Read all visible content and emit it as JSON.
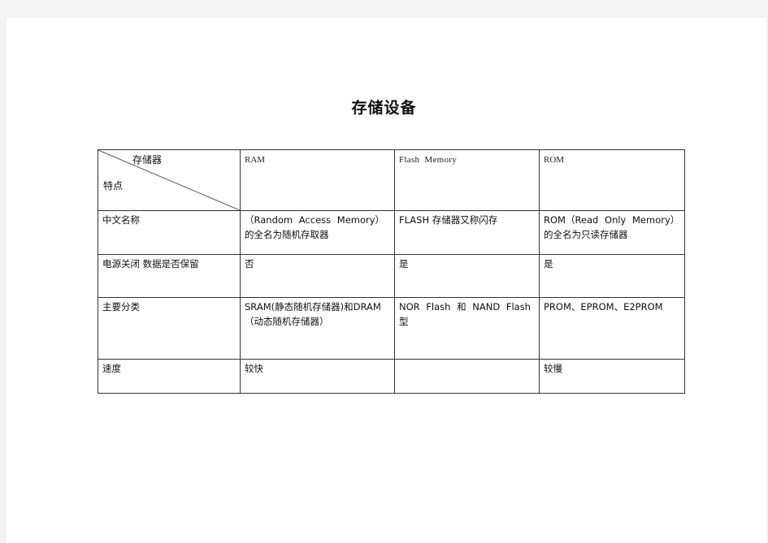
{
  "document": {
    "title": "存储设备"
  },
  "table": {
    "corner": {
      "top_label": "存储器",
      "bottom_label": "特点"
    },
    "columns": [
      "RAM",
      "Flash Memory",
      "ROM"
    ],
    "rows": [
      {
        "label": "中文名称",
        "cells": [
          "（Random Access Memory）的全名为随机存取器",
          "FLASH 存储器又称闪存",
          "ROM（Read Only Memory）的全名为只读存储器"
        ]
      },
      {
        "label": "电源关闭 数据是否保留",
        "cells": [
          "否",
          "是",
          "是"
        ]
      },
      {
        "label": "主要分类",
        "cells": [
          "SRAM(静态随机存储器)和DRAM（动态随机存储器）",
          "NOR Flash 和 NAND Flash 型",
          "PROM、EPROM、E2PROM"
        ]
      },
      {
        "label": "速度",
        "cells": [
          "较快",
          "",
          "较慢"
        ]
      }
    ]
  }
}
